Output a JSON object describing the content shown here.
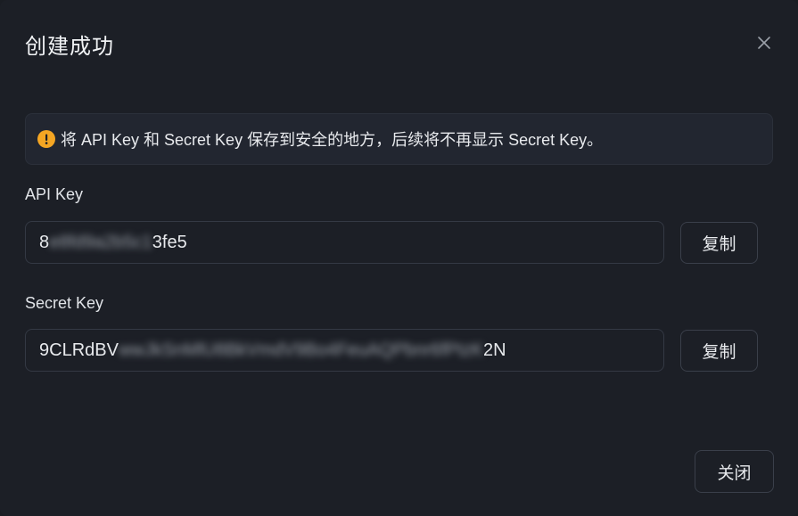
{
  "dialog": {
    "title": "创建成功",
    "close_icon": "close-icon",
    "notice": {
      "icon": "warning-icon",
      "icon_color": "#f5a623",
      "text": "将 API Key 和 Secret Key 保存到安全的地方，后续将不再显示 Secret Key。"
    },
    "api_key": {
      "label": "API Key",
      "value_prefix": "8",
      "value_masked": "e8fd9a2b5c1",
      "value_suffix": "3fe5",
      "copy_label": "复制"
    },
    "secret_key": {
      "label": "Secret Key",
      "value_prefix": "9CLRdBV",
      "value_masked": "wwJkSnMlU8BkVmdV9Bo4FeuAQPbnr6fPtzK",
      "value_suffix": "2N",
      "copy_label": "复制"
    },
    "footer": {
      "close_label": "关闭"
    }
  }
}
